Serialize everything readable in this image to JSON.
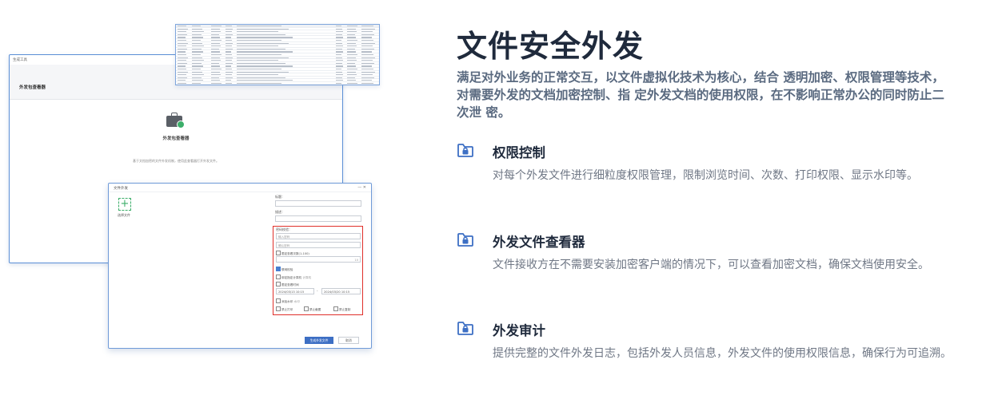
{
  "illustration": {
    "back_window_title": "生成工具",
    "back_tab_label": "外发包查看器",
    "viewer_title": "外发包查看器",
    "viewer_hint": "基于文档加密的文件外发机制，使用此查看器打开外发文件。",
    "dialog_title": "文件外发",
    "dialog_controls": "—   ✕",
    "add_symbol": "+",
    "select_file": "选择文件",
    "field_title": "标题：",
    "field_desc": "描述：",
    "check_label": "密码校验：",
    "placeholder_password": "输入密码",
    "placeholder_confirm": "确认密码",
    "limit_views": "限定查看次数(1-100)",
    "views_value": "10",
    "online_check": "联网校验",
    "bind_machine": "绑定指定计算机",
    "bind_machine_suffix": "计算机",
    "limit_time": "限定查看时间",
    "start_time": "2024/03/13 10:15",
    "end_time": "2024/03/20 10:15",
    "add_watermark": "添加水印",
    "watermark_suffix": "水印",
    "no_print": "禁止打印",
    "no_screenshot": "禁止截图",
    "no_copy": "禁止复制",
    "generate_button": "生成外发文件",
    "cancel_button": "取消"
  },
  "content": {
    "title": "文件安全外发",
    "intro": "满足对外业务的正常交互，以文件虚拟化技术为核心，结合 透明加密、权限管理等技术，对需要外发的文档加密控制、指 定外发文档的使用权限，在不影响正常办公的同时防止二次泄 密。",
    "features": [
      {
        "icon": "folder-lock-icon",
        "title": "权限控制",
        "desc": "对每个外发文件进行细粒度权限管理，限制浏览时间、次数、打印权限、显示水印等。"
      },
      {
        "icon": "folder-lock-icon",
        "title": "外发文件查看器",
        "desc": "文件接收方在不需要安装加密客户端的情况下，可以查看加密文档，确保文档使用安全。"
      },
      {
        "icon": "folder-lock-icon",
        "title": "外发审计",
        "desc": "提供完整的文件外发日志，包括外发人员信息，外发文件的使用权限信息，确保行为可追溯。"
      }
    ]
  },
  "colors": {
    "accent": "#3d6fc4",
    "title": "#1f2a3c",
    "intro": "#5a6a80",
    "highlight_box": "#e0302a"
  }
}
